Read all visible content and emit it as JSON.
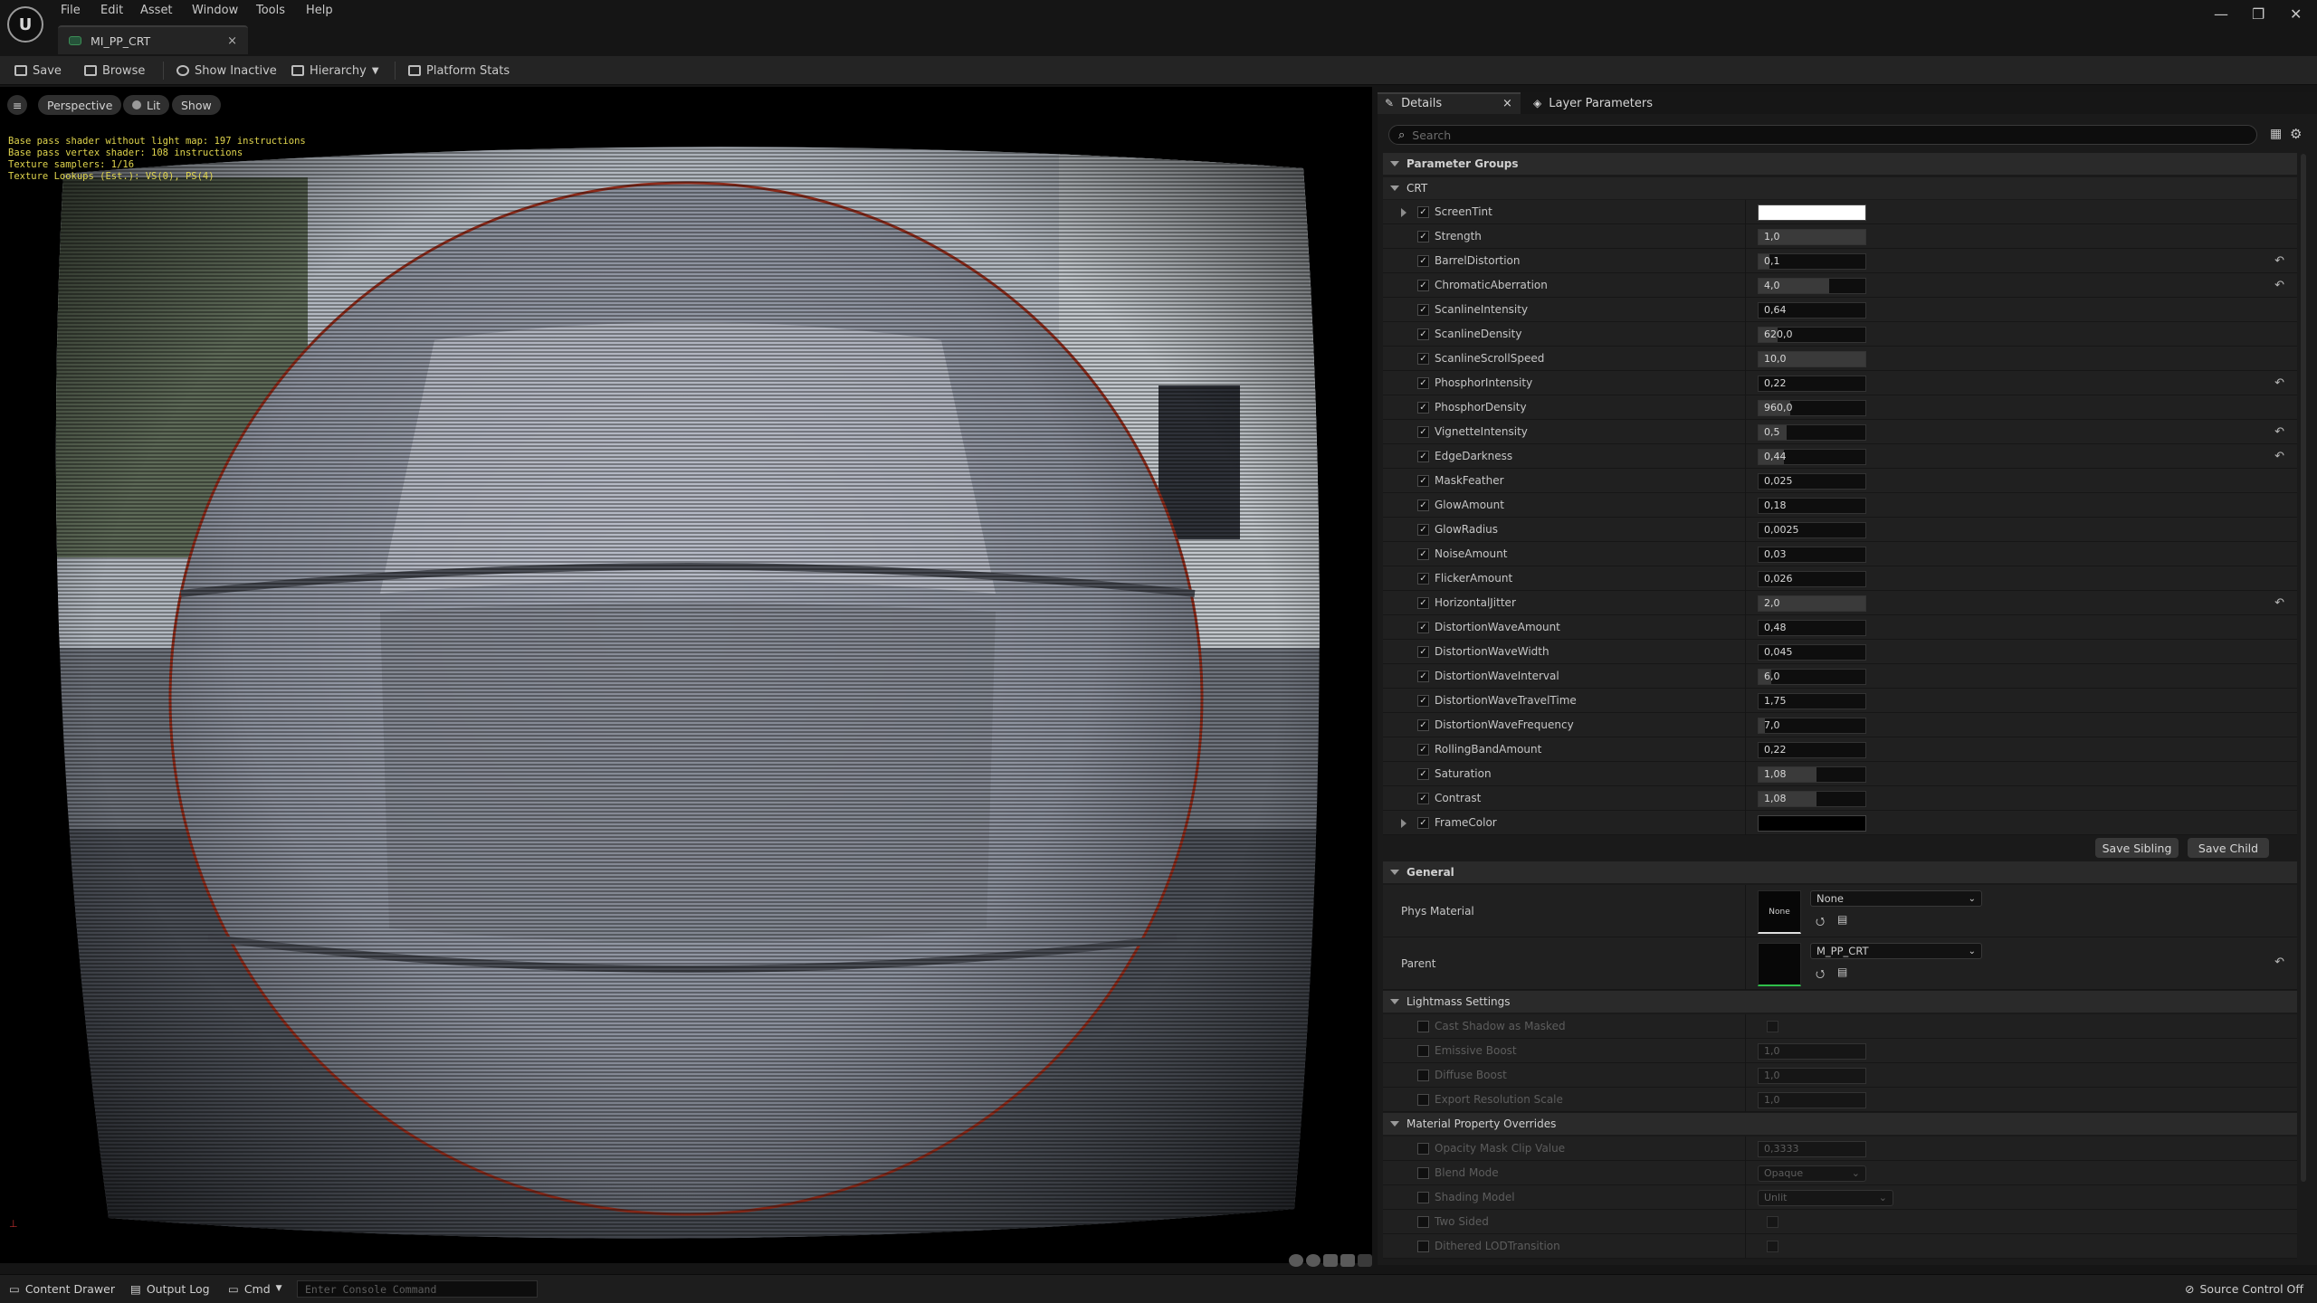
{
  "menus": [
    "File",
    "Edit",
    "Asset",
    "Window",
    "Tools",
    "Help"
  ],
  "logo": "U",
  "doc_tab": {
    "title": "MI_PP_CRT",
    "close": "×"
  },
  "window_controls": {
    "minimize": "—",
    "restore": "❐",
    "close": "✕"
  },
  "toolbar": {
    "save": "Save",
    "browse": "Browse",
    "show_inactive": "Show Inactive",
    "hierarchy": "Hierarchy",
    "platform_stats": "Platform Stats"
  },
  "viewport": {
    "menu_icon": "≡",
    "perspective": "Perspective",
    "lit": "Lit",
    "show": "Show",
    "stats": [
      "Base pass shader without light map: 197 instructions",
      "Base pass vertex shader: 108 instructions",
      "Texture samplers: 1/16",
      "Texture Lookups (Est.): VS(0), PS(4)"
    ]
  },
  "panel_tabs": {
    "details": "Details",
    "close": "×",
    "layer_parameters": "Layer Parameters"
  },
  "search_placeholder": "Search",
  "sections": {
    "parameter_groups": "Parameter Groups",
    "crt": "CRT",
    "general": "General",
    "lightmass": "Lightmass Settings",
    "overrides": "Material Property Overrides"
  },
  "params": [
    {
      "name": "ScreenTint",
      "value": "",
      "kind": "color",
      "color": "#ffffff",
      "expand": true
    },
    {
      "name": "Strength",
      "value": "1,0",
      "fill": 1.0
    },
    {
      "name": "BarrelDistortion",
      "value": "0,1",
      "fill": 0.1,
      "reset": true
    },
    {
      "name": "ChromaticAberration",
      "value": "4,0",
      "fill": 0.66,
      "reset": true
    },
    {
      "name": "ScanlineIntensity",
      "value": "0,64",
      "fill": 0
    },
    {
      "name": "ScanlineDensity",
      "value": "620,0",
      "fill": 0.18
    },
    {
      "name": "ScanlineScrollSpeed",
      "value": "10,0",
      "fill": 1.0
    },
    {
      "name": "PhosphorIntensity",
      "value": "0,22",
      "fill": 0,
      "reset": true
    },
    {
      "name": "PhosphorDensity",
      "value": "960,0",
      "fill": 0.3
    },
    {
      "name": "VignetteIntensity",
      "value": "0,5",
      "fill": 0.26,
      "reset": true
    },
    {
      "name": "EdgeDarkness",
      "value": "0,44",
      "fill": 0.24,
      "reset": true
    },
    {
      "name": "MaskFeather",
      "value": "0,025",
      "fill": 0
    },
    {
      "name": "GlowAmount",
      "value": "0,18",
      "fill": 0
    },
    {
      "name": "GlowRadius",
      "value": "0,0025",
      "fill": 0
    },
    {
      "name": "NoiseAmount",
      "value": "0,03",
      "fill": 0
    },
    {
      "name": "FlickerAmount",
      "value": "0,026",
      "fill": 0
    },
    {
      "name": "HorizontalJitter",
      "value": "2,0",
      "fill": 1.0,
      "reset": true
    },
    {
      "name": "DistortionWaveAmount",
      "value": "0,48",
      "fill": 0
    },
    {
      "name": "DistortionWaveWidth",
      "value": "0,045",
      "fill": 0
    },
    {
      "name": "DistortionWaveInterval",
      "value": "6,0",
      "fill": 0.12
    },
    {
      "name": "DistortionWaveTravelTime",
      "value": "1,75",
      "fill": 0
    },
    {
      "name": "DistortionWaveFrequency",
      "value": "7,0",
      "fill": 0.06
    },
    {
      "name": "RollingBandAmount",
      "value": "0,22",
      "fill": 0
    },
    {
      "name": "Saturation",
      "value": "1,08",
      "fill": 0.54
    },
    {
      "name": "Contrast",
      "value": "1,08",
      "fill": 0.54
    },
    {
      "name": "FrameColor",
      "value": "",
      "kind": "color",
      "color": "#000000",
      "expand": true
    }
  ],
  "buttons": {
    "save_sibling": "Save Sibling",
    "save_child": "Save Child"
  },
  "general": {
    "phys_material_label": "Phys Material",
    "phys_thumb": "None",
    "phys_value": "None",
    "parent_label": "Parent",
    "parent_value": "M_PP_CRT"
  },
  "lightmass": [
    {
      "name": "Cast Shadow as Masked",
      "value": "",
      "kind": "check"
    },
    {
      "name": "Emissive Boost",
      "value": "1,0"
    },
    {
      "name": "Diffuse Boost",
      "value": "1,0"
    },
    {
      "name": "Export Resolution Scale",
      "value": "1,0"
    }
  ],
  "overrides": [
    {
      "name": "Opacity Mask Clip Value",
      "value": "0,3333"
    },
    {
      "name": "Blend Mode",
      "value": "Opaque",
      "kind": "dropdown"
    },
    {
      "name": "Shading Model",
      "value": "Unlit",
      "kind": "dropdown"
    },
    {
      "name": "Two Sided",
      "value": "",
      "kind": "check"
    },
    {
      "name": "Dithered LODTransition",
      "value": "",
      "kind": "check"
    }
  ],
  "bottom": {
    "content_drawer": "Content Drawer",
    "output_log": "Output Log",
    "cmd": "Cmd",
    "console_placeholder": "Enter Console Command",
    "source_control": "Source Control Off"
  }
}
